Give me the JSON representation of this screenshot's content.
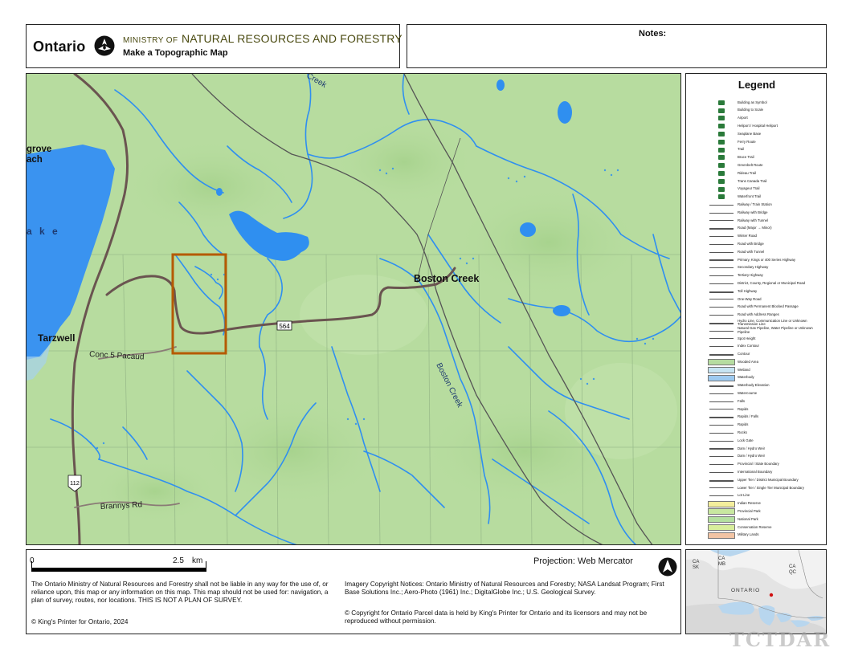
{
  "header": {
    "brand": "Ontario",
    "ministry_prefix": "MINISTRY OF",
    "ministry_name": "NATURAL RESOURCES AND FORESTRY",
    "subtitle": "Make a Topographic Map",
    "notes_label": "Notes:"
  },
  "map": {
    "place_labels": {
      "boston_creek": "Boston Creek",
      "tarzwell": "Tarzwell",
      "grove_partial": "grove",
      "beach_partial": "ach",
      "lake_partial": "a k e"
    },
    "road_labels": {
      "conc": "Conc 5 Pacaud",
      "brannys": "Brannys Rd",
      "hwy_564": "564",
      "hwy_112": "112"
    },
    "water_labels": {
      "boston_creek_river": "Boston Creek",
      "creek_top": "Creek"
    },
    "colors": {
      "land": "#b7dc9f",
      "water": "#2f8ff0",
      "road": "#6a5450",
      "highlight": "#b55a00"
    }
  },
  "legend": {
    "title": "Legend",
    "items": [
      {
        "label": "Building as Symbol",
        "icon": "building-icon"
      },
      {
        "label": "Building to Scale",
        "icon": "building-scale-icon"
      },
      {
        "label": "Airport",
        "icon": "airport-icon"
      },
      {
        "label": "Heliport / Hospital Heliport",
        "icon": "heliport-icon"
      },
      {
        "label": "Seaplane Base",
        "icon": "seaplane-icon"
      },
      {
        "label": "Ferry Route",
        "icon": "ferry-icon"
      },
      {
        "label": "Trail",
        "icon": "trail-icon"
      },
      {
        "label": "Bruce Trail",
        "icon": "bruce-trail-icon"
      },
      {
        "label": "Greenbelt Route",
        "icon": "greenbelt-icon"
      },
      {
        "label": "Rideau Trail",
        "icon": "rideau-icon"
      },
      {
        "label": "Trans Canada Trail",
        "icon": "trans-canada-icon"
      },
      {
        "label": "Voyageur Trail",
        "icon": "voyageur-icon"
      },
      {
        "label": "Waterfront Trail",
        "icon": "waterfront-icon"
      },
      {
        "label": "Railway / Train Station",
        "icon": "railway-icon"
      },
      {
        "label": "Railway with Bridge",
        "icon": "rail-bridge-icon"
      },
      {
        "label": "Railway with Tunnel",
        "icon": "rail-tunnel-icon"
      },
      {
        "label": "Road (Major → Minor)",
        "icon": "road-icon"
      },
      {
        "label": "Winter Road",
        "icon": "winter-road-icon"
      },
      {
        "label": "Road with Bridge",
        "icon": "road-bridge-icon"
      },
      {
        "label": "Road with Tunnel",
        "icon": "road-tunnel-icon"
      },
      {
        "label": "Primary, Kings or 400 Series Highway",
        "icon": "primary-hwy-icon"
      },
      {
        "label": "Secondary Highway",
        "icon": "secondary-hwy-icon"
      },
      {
        "label": "Tertiary Highway",
        "icon": "tertiary-hwy-icon"
      },
      {
        "label": "District, County, Regional or Municipal Road",
        "icon": "district-road-icon"
      },
      {
        "label": "Toll Highway",
        "icon": "toll-hwy-icon"
      },
      {
        "label": "One-Way Road",
        "icon": "one-way-icon"
      },
      {
        "label": "Road with Permanent Blocked Passage",
        "icon": "blocked-road-icon"
      },
      {
        "label": "Road with Address Ranges",
        "icon": "address-road-icon"
      },
      {
        "label": "Hydro Line, Communication Line or Unknown Transmission Line",
        "icon": "hydro-line-icon"
      },
      {
        "label": "Natural Gas Pipeline, Water Pipeline or Unknown Pipeline",
        "icon": "pipeline-icon"
      },
      {
        "label": "Spot Height",
        "icon": "spot-height-icon"
      },
      {
        "label": "Index Contour",
        "icon": "index-contour-icon"
      },
      {
        "label": "Contour",
        "icon": "contour-icon"
      },
      {
        "label": "Wooded Area",
        "icon": "wooded-icon"
      },
      {
        "label": "Wetland",
        "icon": "wetland-icon"
      },
      {
        "label": "Waterbody",
        "icon": "waterbody-icon"
      },
      {
        "label": "Waterbody Elevation",
        "icon": "water-elev-icon"
      },
      {
        "label": "Watercourse",
        "icon": "watercourse-icon"
      },
      {
        "label": "Falls",
        "icon": "falls-icon"
      },
      {
        "label": "Rapids",
        "icon": "rapids-icon"
      },
      {
        "label": "Rapids / Falls",
        "icon": "rapids-falls-icon"
      },
      {
        "label": "Rapids",
        "icon": "rapids2-icon"
      },
      {
        "label": "Rocks",
        "icon": "rocks-icon"
      },
      {
        "label": "Lock Gate",
        "icon": "lock-gate-icon"
      },
      {
        "label": "Dam / Hydro Weir",
        "icon": "dam-icon"
      },
      {
        "label": "Dam / Hydro Weir",
        "icon": "dam2-icon"
      },
      {
        "label": "Provincial / State Boundary",
        "icon": "prov-boundary-icon"
      },
      {
        "label": "International Boundary",
        "icon": "intl-boundary-icon"
      },
      {
        "label": "Upper Tier / District Municipal Boundary",
        "icon": "upper-tier-icon"
      },
      {
        "label": "Lower Tier / Single Tier Municipal Boundary",
        "icon": "lower-tier-icon"
      },
      {
        "label": "Lot Line",
        "icon": "lot-line-icon"
      },
      {
        "label": "Indian Reserve",
        "icon": "reserve-icon"
      },
      {
        "label": "Provincial Park",
        "icon": "prov-park-icon"
      },
      {
        "label": "National Park",
        "icon": "nat-park-icon"
      },
      {
        "label": "Conservation Reserve",
        "icon": "conservation-icon"
      },
      {
        "label": "Military Lands",
        "icon": "military-icon"
      }
    ]
  },
  "footer": {
    "scale_zero": "0",
    "scale_mid": "2.5",
    "scale_unit": "km",
    "projection": "Projection: Web Mercator",
    "disclaimer": "The Ontario Ministry of Natural Resources and Forestry shall not be liable in any way for the use of, or reliance upon, this map or any information on this map. This map should not be used for: navigation, a plan of survey, routes, nor locations. THIS IS NOT A PLAN OF SURVEY.",
    "kings_printer": "© King's Printer for Ontario,  2024",
    "imagery": "Imagery Copyright Notices: Ontario Ministry of Natural Resources and Forestry; NASA Landsat Program; First Base Solutions Inc.; Aero-Photo (1961) Inc.; DigitalGlobe Inc.; U.S. Geological Survey.",
    "parcel": "© Copyright for Ontario Parcel data is held by King's Printer for Ontario and its licensors and may not be reproduced without permission."
  },
  "inset": {
    "labels": {
      "ca_sk": "CA\nSK",
      "ca_mb": "CA\nMB",
      "ca_qc": "CA\nQC",
      "ontario": "ONTARIO"
    }
  },
  "watermark": "TCTDAR"
}
